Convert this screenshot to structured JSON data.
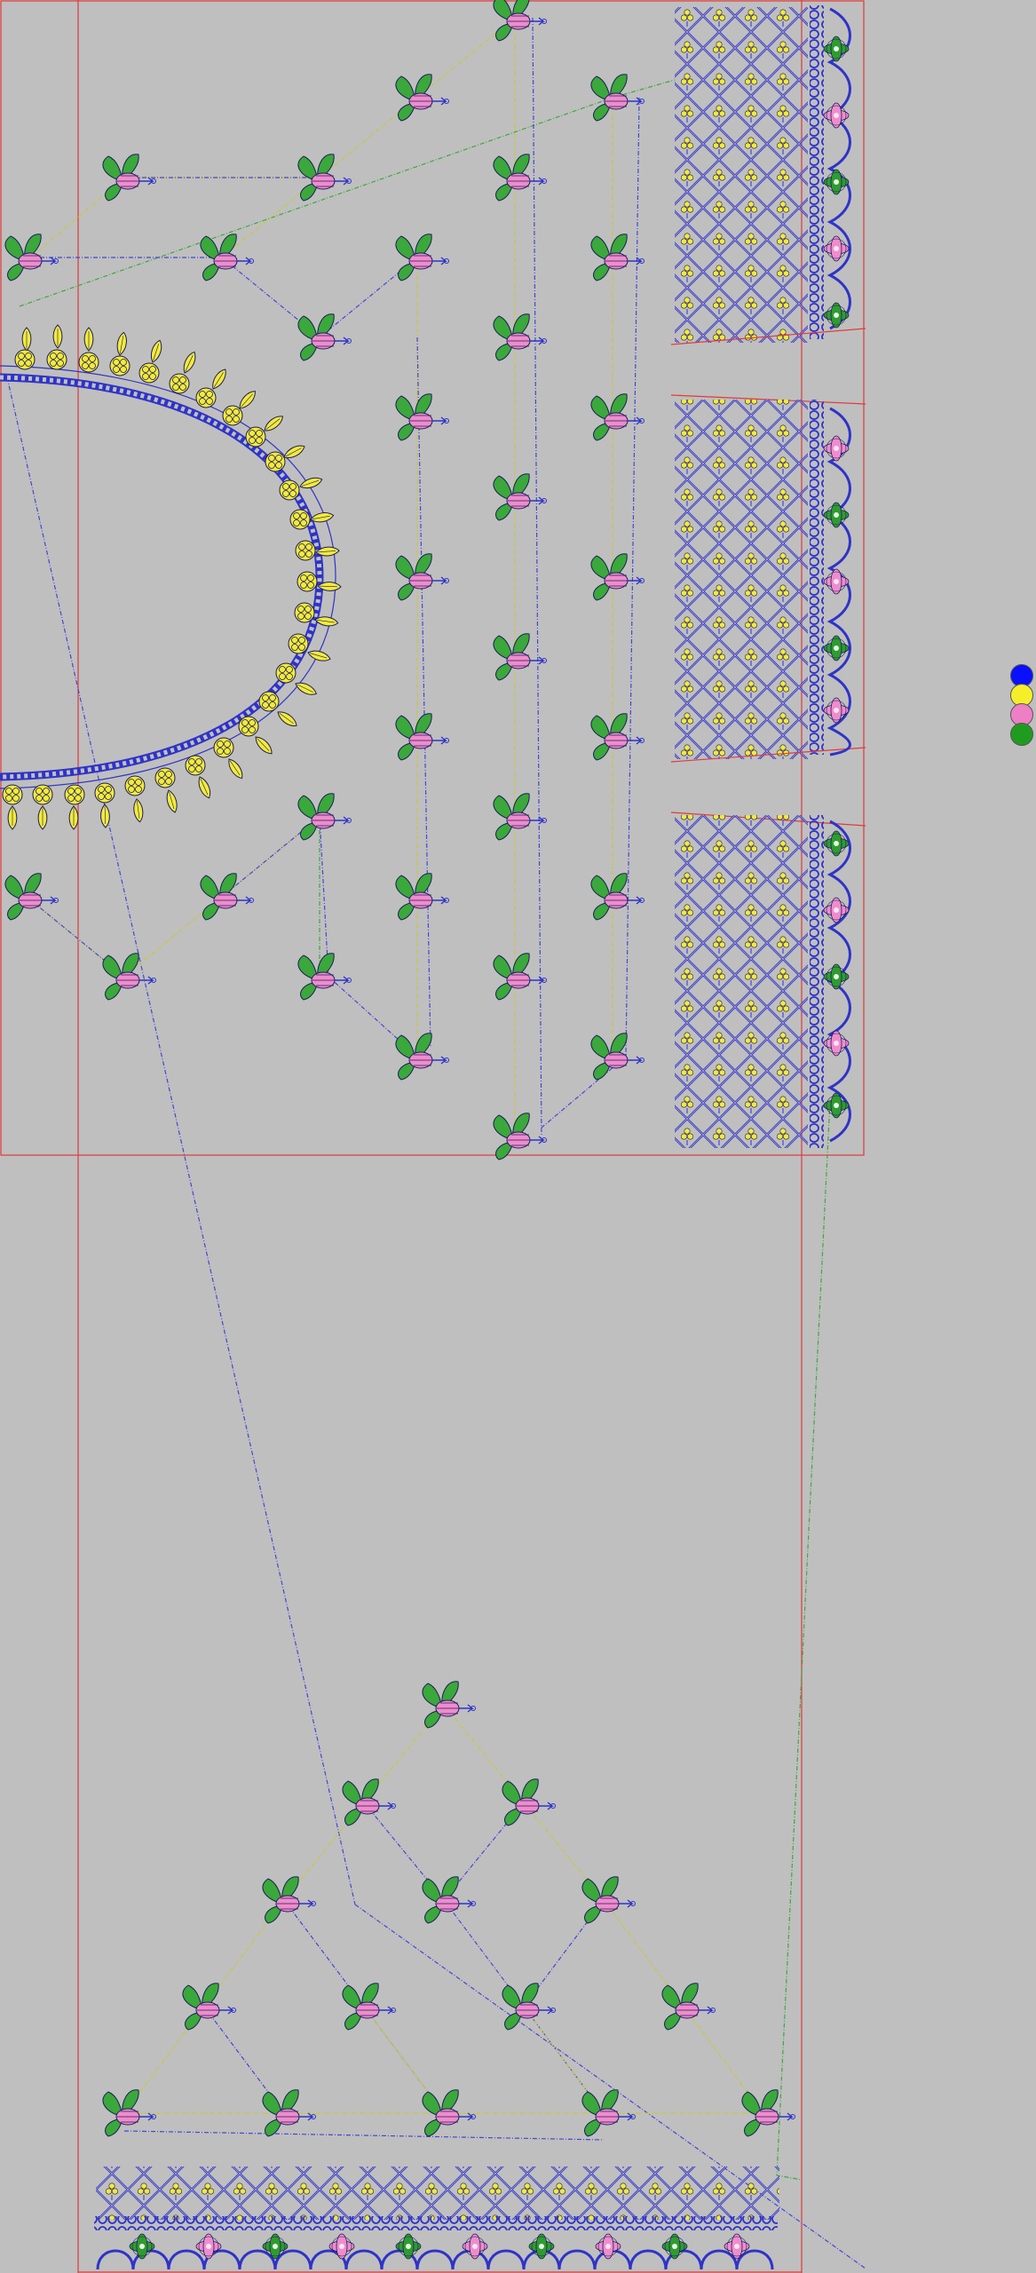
{
  "colors": {
    "background": "#bfbfbf",
    "hoop_outline": "#e03a3a",
    "thread_blue": "#2f33c8",
    "thread_yellow": "#f2ea3c",
    "thread_pink": "#f08ccc",
    "thread_green": "#2e9c2e",
    "outline_dark": "#1c1c5a",
    "jump_blue": "#4545d8",
    "jump_green": "#3ea83e",
    "jump_yellow": "#c8c83c"
  },
  "palette": [
    {
      "name": "blue",
      "color": "#0a10ff"
    },
    {
      "name": "yellow",
      "color": "#f5ef2a"
    },
    {
      "name": "pink",
      "color": "#ef7fc5"
    },
    {
      "name": "green",
      "color": "#1f9c1f"
    }
  ],
  "motif_icon": "flower-bud-icon"
}
